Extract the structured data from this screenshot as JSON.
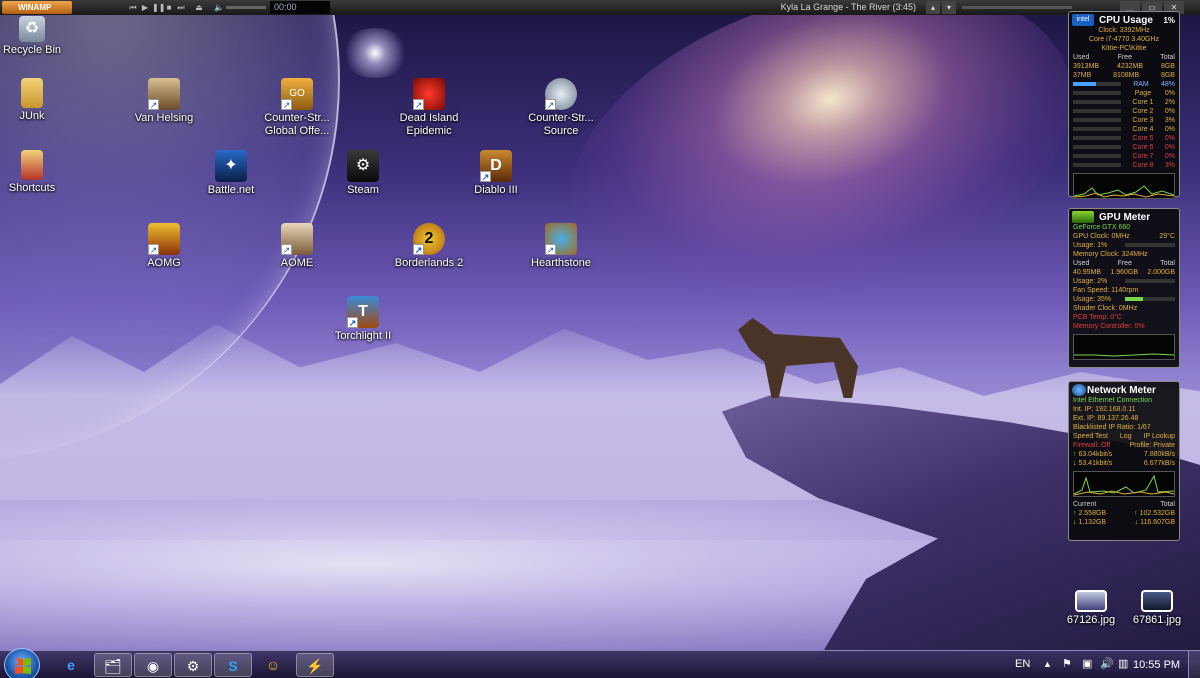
{
  "winamp": {
    "title": "WINAMP",
    "time": "00:00",
    "track": "Kyla La Grange - The River (3:45)"
  },
  "desktop_icons": [
    {
      "label": "Recycle Bin",
      "icon": "recycle-bin-icon"
    },
    {
      "label": "JUnk",
      "icon": "folder-icon"
    },
    {
      "label": "Shortcuts",
      "icon": "folder-icon"
    },
    {
      "label": "Van Helsing",
      "icon": "van-helsing-icon"
    },
    {
      "label": "Counter-Str... Global Offe...",
      "icon": "csgo-icon"
    },
    {
      "label": "Dead Island Epidemic",
      "icon": "dead-island-icon"
    },
    {
      "label": "Counter-Str... Source",
      "icon": "css-icon"
    },
    {
      "label": "Battle.net",
      "icon": "battlenet-icon"
    },
    {
      "label": "Steam",
      "icon": "steam-icon"
    },
    {
      "label": "Diablo III",
      "icon": "diablo-icon"
    },
    {
      "label": "AOMG",
      "icon": "aomg-icon"
    },
    {
      "label": "AOME",
      "icon": "aome-icon"
    },
    {
      "label": "Borderlands 2",
      "icon": "borderlands-icon"
    },
    {
      "label": "Hearthstone",
      "icon": "hearthstone-icon"
    },
    {
      "label": "Torchlight II",
      "icon": "torchlight-icon"
    },
    {
      "label": "67126.jpg",
      "icon": "image-file-icon"
    },
    {
      "label": "67861.jpg",
      "icon": "image-file-icon"
    }
  ],
  "cpu_meter": {
    "title": "CPU Usage",
    "percent": "1%",
    "clock": "Clock: 3392MHz",
    "cpu_name": "Core i7-4770 3.40GHz",
    "machine": "Kittie-PC\\Kittie",
    "headers": [
      "Used",
      "Free",
      "Total"
    ],
    "ram_row": [
      "3913MB",
      "4232MB",
      "8GB"
    ],
    "page_row": [
      "37MB",
      "8108MB",
      "8GB"
    ],
    "ram_label": "RAM",
    "ram_pct": "48%",
    "page_label": "Page",
    "page_pct": "0%",
    "cores": [
      {
        "label": "Core 1",
        "value": "2%"
      },
      {
        "label": "Core 2",
        "value": "0%"
      },
      {
        "label": "Core 3",
        "value": "3%"
      },
      {
        "label": "Core 4",
        "value": "0%"
      },
      {
        "label": "Core 5",
        "value": "0%"
      },
      {
        "label": "Core 6",
        "value": "0%"
      },
      {
        "label": "Core 7",
        "value": "0%"
      },
      {
        "label": "Core 8",
        "value": "3%"
      }
    ]
  },
  "gpu_meter": {
    "title": "GPU Meter",
    "gpu_name": "GeForce GTX 660",
    "gpu_clock": "GPU Clock: 0MHz",
    "temp": "29°C",
    "usage": "Usage: 1%",
    "mem_clock": "Memory Clock: 324MHz",
    "headers": [
      "Used",
      "Free",
      "Total"
    ],
    "mem_row": [
      "40.95MB",
      "1.960GB",
      "2.000GB"
    ],
    "mem_usage": "Usage: 2%",
    "fan_speed": "Fan Speed: 1140rpm",
    "fan_usage": "Usage: 35%",
    "shader_clock": "Shader Clock: 0MHz",
    "pcb_temp": "PCB Temp: 0°C",
    "mem_controller": "Memory Controller: 0%"
  },
  "network_meter": {
    "title": "Network Meter",
    "adapter": "Intel Ethernet Connection",
    "int_ip": "Int. IP: 192.168.0.11",
    "ext_ip": "Ext. IP: 89.137.26.48",
    "blacklist": "Blacklisted IP Ratio: 1/67",
    "speed_test": "Speed Test",
    "log": "Log",
    "ip_lookup": "IP Lookup",
    "firewall": "Firewall: Off",
    "profile": "Profile: Private",
    "up_speed_a": "63.04kbit/s",
    "up_speed_b": "7.880kB/s",
    "down_speed_a": "53.41kbit/s",
    "down_speed_b": "6.677kB/s",
    "current_label": "Current",
    "total_label": "Total",
    "current_up": "2.558GB",
    "current_down": "1.132GB",
    "total_up": "102.532GB",
    "total_down": "116.607GB"
  },
  "taskbar": {
    "apps": [
      "internet-explorer-icon",
      "explorer-icon",
      "chrome-icon",
      "steam-icon",
      "skype-icon",
      "messenger-icon",
      "winamp-icon"
    ],
    "language": "EN",
    "clock": "10:55 PM"
  }
}
